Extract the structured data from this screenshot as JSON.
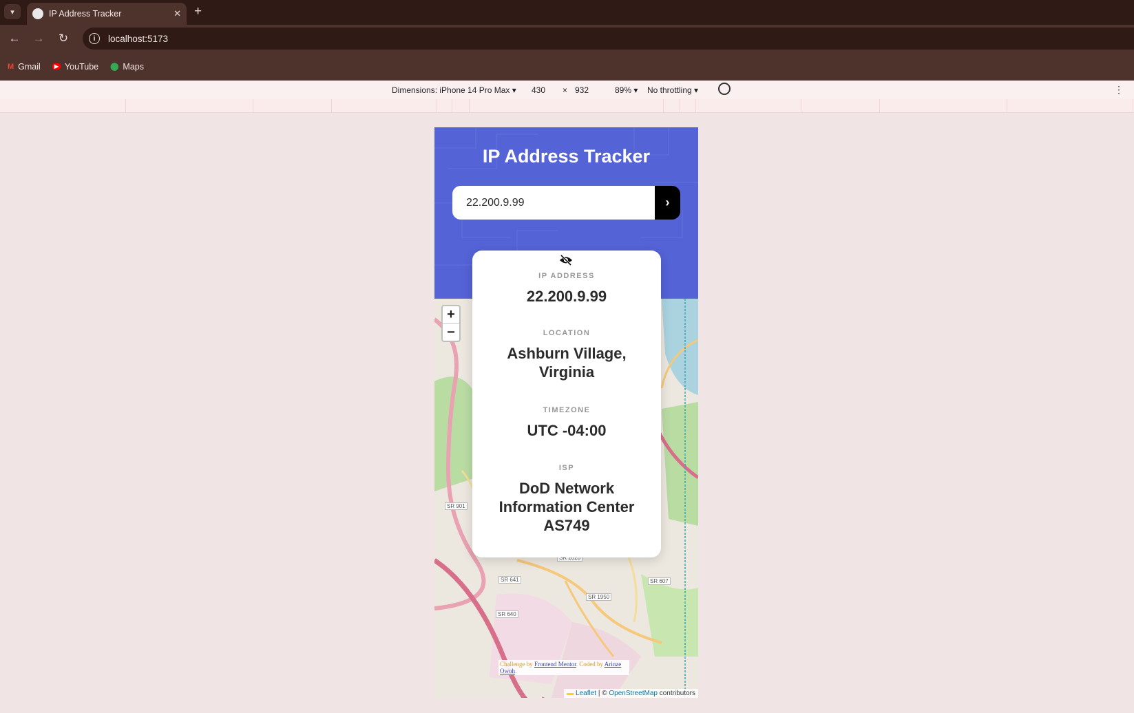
{
  "browser": {
    "tab_title": "IP Address Tracker",
    "url": "localhost:5173",
    "bookmarks": [
      {
        "label": "Gmail",
        "icon": "gmail-icon"
      },
      {
        "label": "YouTube",
        "icon": "youtube-icon"
      },
      {
        "label": "Maps",
        "icon": "maps-icon"
      }
    ]
  },
  "devtools": {
    "dimensions_label": "Dimensions: iPhone 14 Pro Max",
    "width": "430",
    "x": "×",
    "height": "932",
    "zoom": "89%",
    "throttling": "No throttling"
  },
  "app": {
    "title": "IP Address Tracker",
    "search_value": "22.200.9.99",
    "fields": [
      {
        "label": "IP ADDRESS",
        "value": "22.200.9.99"
      },
      {
        "label": "LOCATION",
        "value": "Ashburn Village, Virginia"
      },
      {
        "label": "TIMEZONE",
        "value": "UTC -04:00"
      },
      {
        "label": "ISP",
        "value": "DoD Network Information Center AS749"
      }
    ]
  },
  "map": {
    "zoom_in": "+",
    "zoom_out": "−",
    "attrib_leaflet": "Leaflet",
    "attrib_sep": " | © ",
    "attrib_osm": "OpenStreetMap",
    "attrib_contrib": " contributors",
    "credit_challenge": "Challenge by ",
    "credit_fm": "Frontend Mentor",
    "credit_coded": ". Coded by ",
    "credit_author": "Arinze Owoh",
    "credit_end": ".",
    "road_labels": [
      "SR 901",
      "SR 2020",
      "SR 641",
      "SR 607",
      "SR 1950",
      "SR 640"
    ]
  },
  "colors": {
    "header_bg": "#5463d6",
    "page_bg": "#f1e4e4",
    "chrome_dark": "#301a16",
    "chrome": "#4e332d"
  }
}
